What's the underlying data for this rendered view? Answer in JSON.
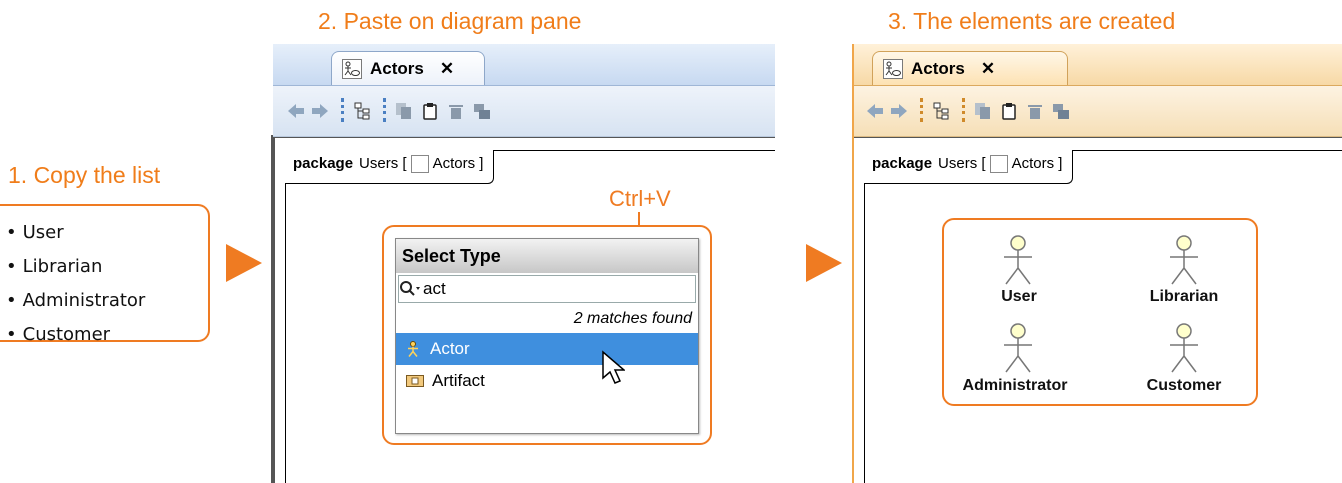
{
  "steps": {
    "step1": "1. Copy the list",
    "step2": "2. Paste on diagram pane",
    "step3": "3. The elements are created"
  },
  "list_items": [
    "User",
    "Librarian",
    "Administrator",
    "Customer"
  ],
  "shortcut_hint": "Ctrl+V",
  "pane": {
    "tab_title": "Actors",
    "tab_close": "✕",
    "package_keyword": "package",
    "package_name": "Users",
    "bracket_open": "[",
    "diagram_name": "Actors",
    "bracket_close": "]"
  },
  "select_type": {
    "title": "Select Type",
    "search_value": "act",
    "matches_text": "2 matches found",
    "results": [
      "Actor",
      "Artifact"
    ],
    "selected_index": 0
  },
  "created_actors": [
    "User",
    "Librarian",
    "Administrator",
    "Customer"
  ],
  "colors": {
    "accent": "#ef7b22",
    "selection": "#3f8fde"
  },
  "icons": {
    "toolbar": [
      "back-arrow-icon",
      "forward-arrow-icon",
      "tree-icon",
      "copy-icon",
      "paste-icon",
      "delete-icon",
      "layers-icon"
    ],
    "search": "search-icon",
    "actor": "actor-icon",
    "artifact": "artifact-icon",
    "cursor": "mouse-cursor-icon"
  }
}
